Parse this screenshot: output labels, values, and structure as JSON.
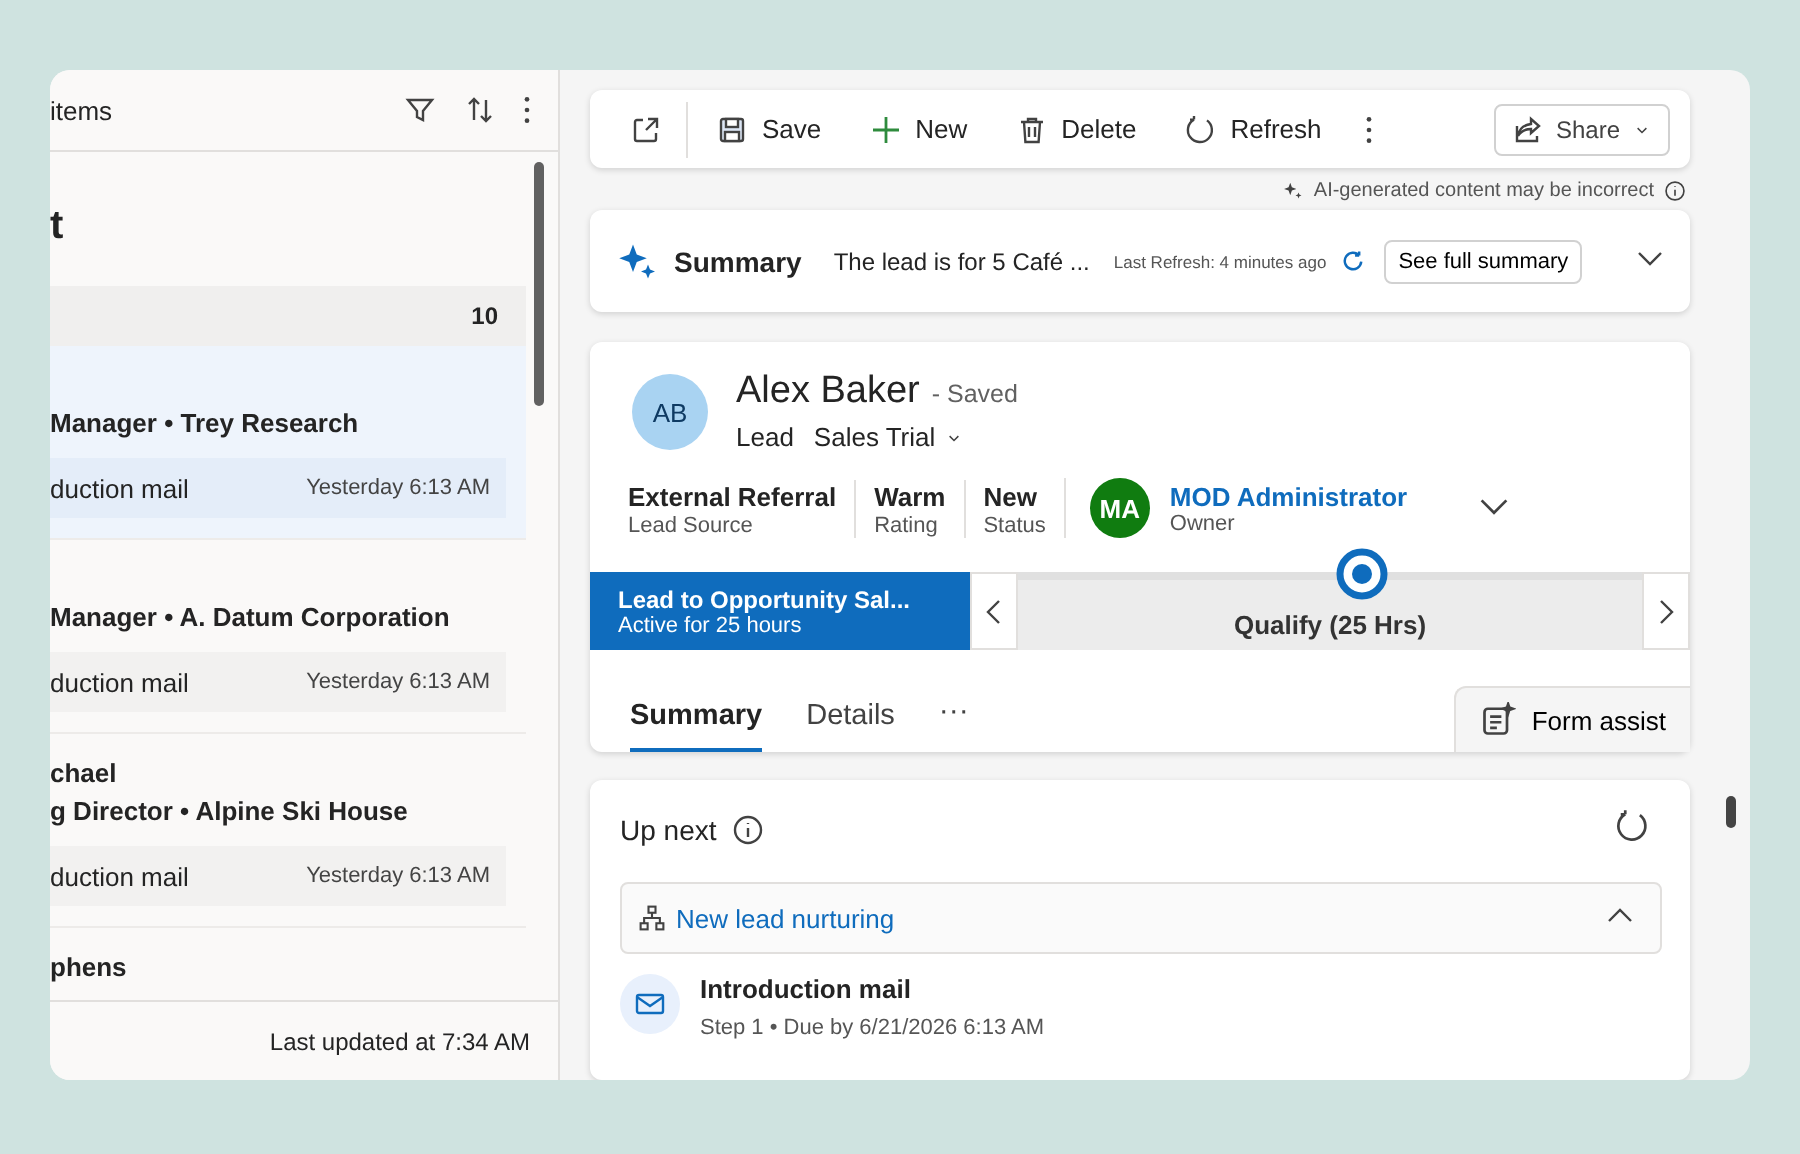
{
  "list_panel": {
    "header": "items",
    "title": "t",
    "group_count": "10",
    "cards": [
      {
        "selected": true,
        "subtitle": "Manager • Trey Research",
        "activity": "duction mail",
        "time": "Yesterday 6:13 AM"
      },
      {
        "selected": false,
        "subtitle": "Manager • A. Datum Corporation",
        "activity": "duction mail",
        "time": "Yesterday 6:13 AM"
      },
      {
        "selected": false,
        "name": "chael",
        "subtitle": "g Director • Alpine Ski House",
        "activity": "duction mail",
        "time": "Yesterday 6:13 AM"
      },
      {
        "selected": false,
        "name": "phens"
      }
    ],
    "footer": "Last updated at 7:34 AM"
  },
  "toolbar": {
    "items": [
      {
        "kind": "popout"
      },
      {
        "kind": "save",
        "label": "Save"
      },
      {
        "kind": "new",
        "label": "New"
      },
      {
        "kind": "delete",
        "label": "Delete"
      },
      {
        "kind": "refresh",
        "label": "Refresh"
      },
      {
        "kind": "more"
      }
    ],
    "share": "Share"
  },
  "ai_note": "AI-generated content may be incorrect",
  "summary": {
    "title": "Summary",
    "text": "The lead is for 5 Café ...",
    "last_refresh": "Last Refresh: 4 minutes ago",
    "button": "See full summary"
  },
  "lead": {
    "initials": "AB",
    "name": "Alex Baker",
    "status": "- Saved",
    "entity": "Lead",
    "form": "Sales Trial",
    "fields": [
      {
        "value": "External Referral",
        "label": "Lead Source"
      },
      {
        "value": "Warm",
        "label": "Rating"
      },
      {
        "value": "New",
        "label": "Status"
      }
    ],
    "owner": {
      "initials": "MA",
      "name": "MOD Administrator",
      "label": "Owner"
    },
    "process": {
      "name": "Lead to Opportunity Sal...",
      "duration": "Active for 25 hours",
      "stage": "Qualify  (25 Hrs)"
    },
    "tabs": [
      {
        "label": "Summary",
        "selected": true
      },
      {
        "label": "Details",
        "selected": false
      }
    ],
    "more": "···",
    "form_assist": "Form assist"
  },
  "up_next": {
    "title": "Up next",
    "sequence": "New lead nurturing",
    "step": {
      "title": "Introduction mail",
      "detail": "Step 1 • Due by 6/21/2026 6:13 AM"
    }
  }
}
